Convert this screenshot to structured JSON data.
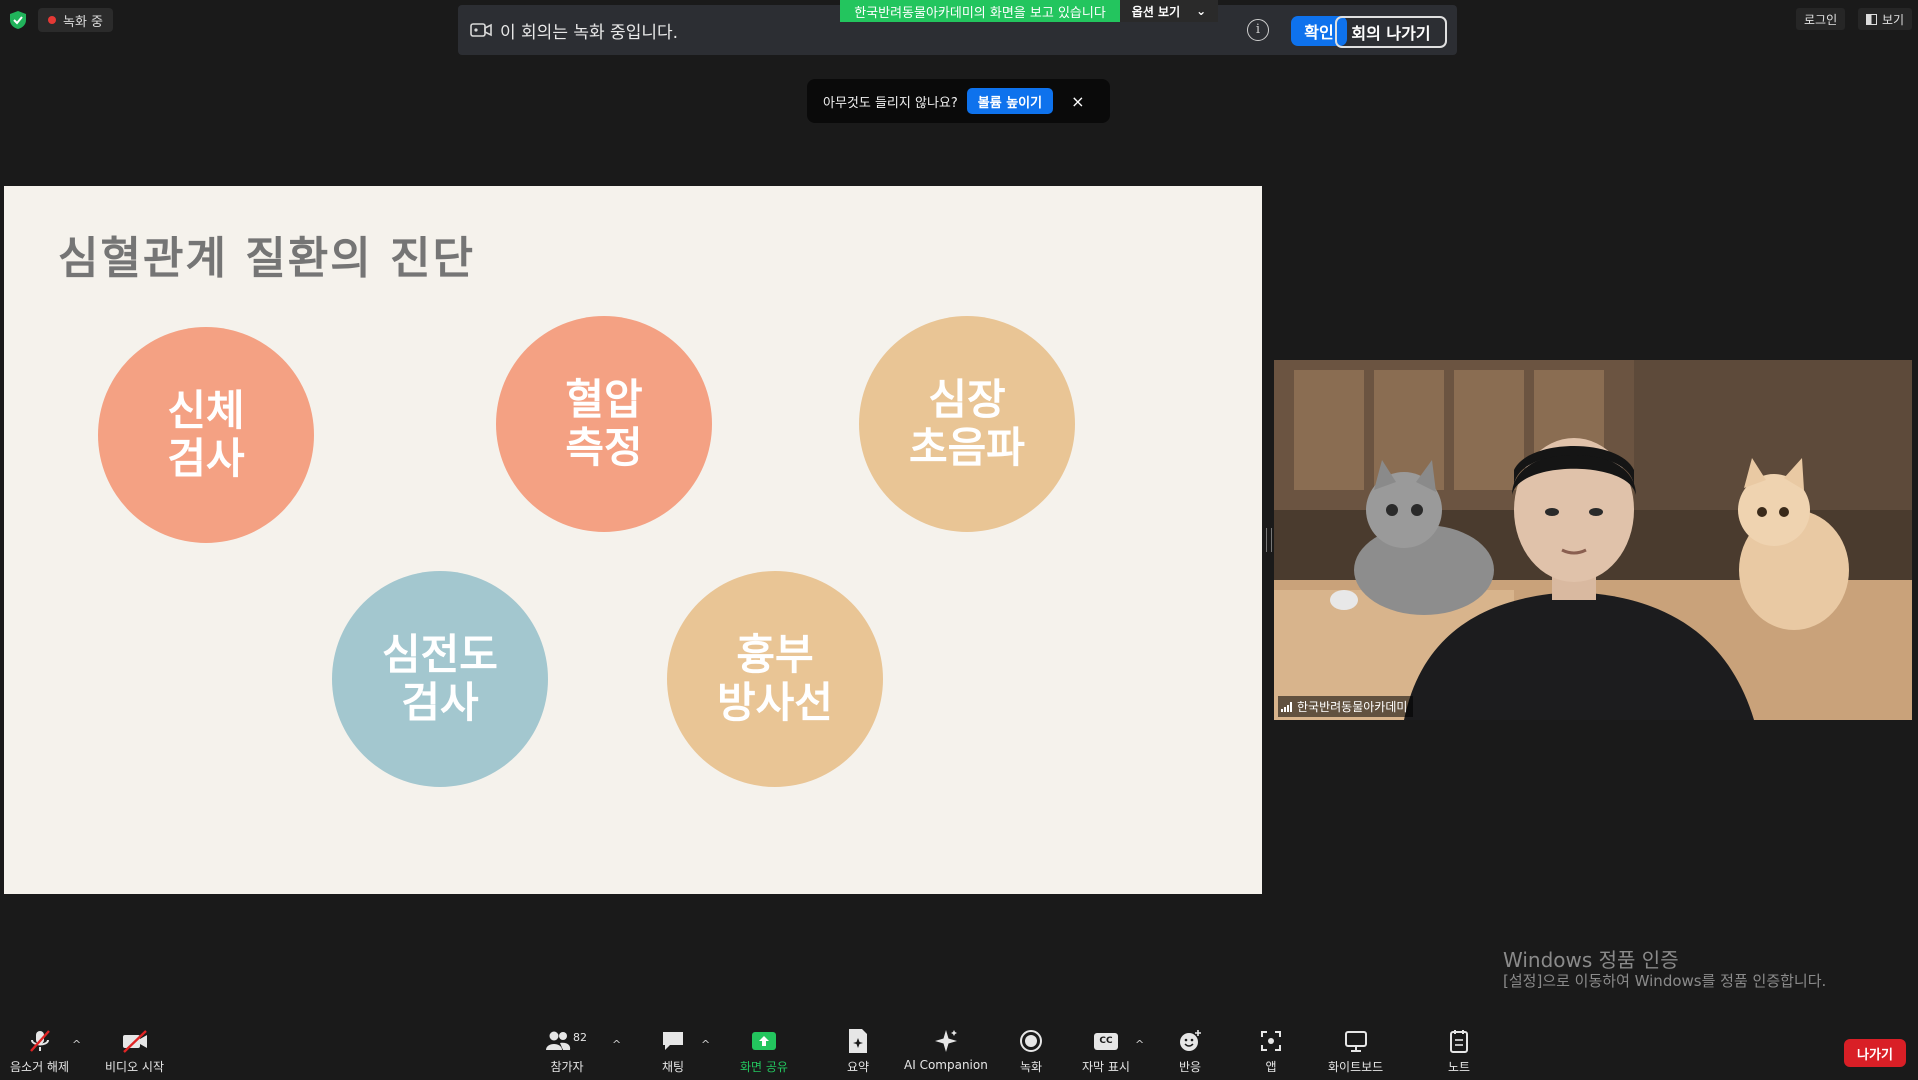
{
  "topbar": {
    "recording_label": "녹화 중",
    "login_label": "로그인",
    "view_label": "보기"
  },
  "notice": {
    "text": "이 회의는 녹화 중입니다.",
    "info_glyph": "i",
    "confirm_label": "확인",
    "leave_meeting_label": "회의 나가기"
  },
  "viewing_banner": {
    "text": "한국반려동물아카데미의 화면을 보고 있습니다",
    "options_label": "옵션 보기",
    "options_caret": "⌄"
  },
  "toast": {
    "text": "아무것도 들리지 않나요?",
    "button_label": "볼륨 높이기",
    "close_glyph": "×"
  },
  "slide": {
    "title": "심혈관계 질환의 진단",
    "circles": [
      {
        "label": "신체\n검사",
        "color": "#f4a183"
      },
      {
        "label": "혈압\n측정",
        "color": "#f4a183"
      },
      {
        "label": "심장\n초음파",
        "color": "#e9c595"
      },
      {
        "label": "심전도\n검사",
        "color": "#a3c7cf"
      },
      {
        "label": "흉부\n방사선",
        "color": "#e9c595"
      }
    ]
  },
  "video": {
    "participant_name": "한국반려동물아카데미"
  },
  "watermark": {
    "title": "Windows 정품 인증",
    "subtitle": "[설정]으로 이동하여 Windows를 정품 인증합니다."
  },
  "toolbar": {
    "mute_label": "음소거 해제",
    "video_label": "비디오 시작",
    "participants_label": "참가자",
    "participants_count": "82",
    "chat_label": "채팅",
    "share_label": "화면 공유",
    "summary_label": "요약",
    "ai_label": "AI Companion",
    "record_label": "녹화",
    "cc_label": "자막 표시",
    "cc_glyph": "CC",
    "reaction_label": "반응",
    "apps_label": "앱",
    "whiteboard_label": "화이트보드",
    "notes_label": "노트",
    "leave_label": "나가기",
    "caret_glyph": "^"
  },
  "colors": {
    "accent_blue": "#0e72ed",
    "share_green": "#23c55e",
    "leave_red": "#d91f26"
  }
}
